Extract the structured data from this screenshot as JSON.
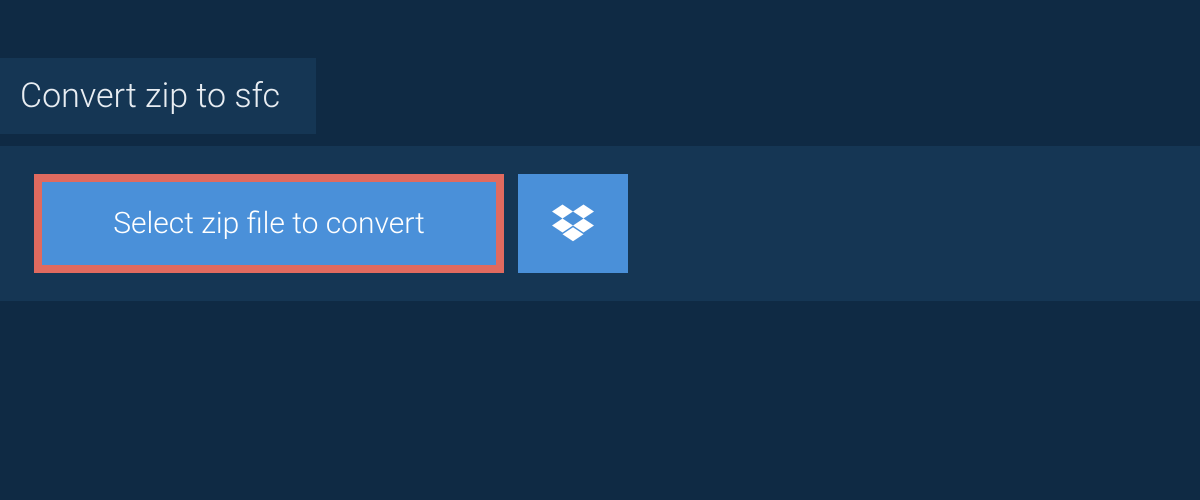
{
  "header": {
    "title": "Convert zip to sfc"
  },
  "upload": {
    "select_label": "Select zip file to convert"
  }
}
